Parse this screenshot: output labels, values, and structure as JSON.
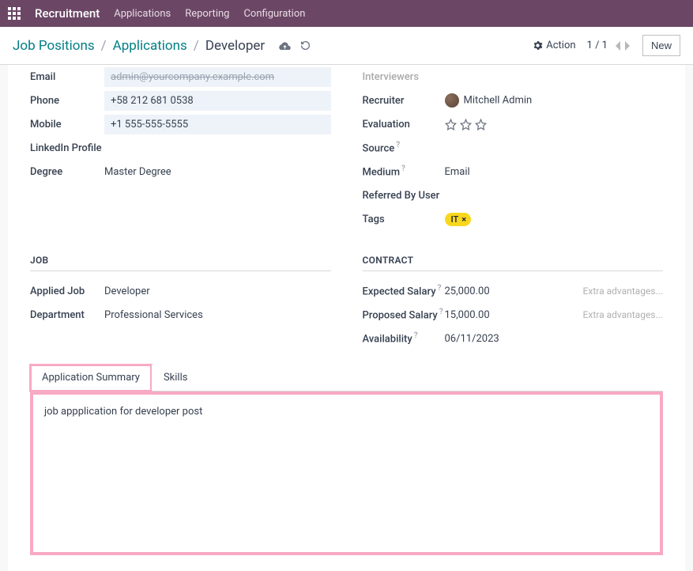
{
  "topbar": {
    "brand": "Recruitment",
    "menu": [
      "Applications",
      "Reporting",
      "Configuration"
    ]
  },
  "header": {
    "breadcrumb": {
      "items": [
        "Job Positions",
        "Applications"
      ],
      "current": "Developer"
    },
    "action_label": "Action",
    "pager": "1 / 1",
    "new_label": "New"
  },
  "left": {
    "email_label": "Email",
    "email_value": "admin@yourcompany.example.com",
    "phone_label": "Phone",
    "phone_value": "+58 212 681 0538",
    "mobile_label": "Mobile",
    "mobile_value": "+1 555-555-5555",
    "linkedin_label": "LinkedIn Profile",
    "linkedin_value": "",
    "degree_label": "Degree",
    "degree_value": "Master Degree"
  },
  "right": {
    "interviewers_label": "Interviewers",
    "recruiter_label": "Recruiter",
    "recruiter_value": "Mitchell Admin",
    "evaluation_label": "Evaluation",
    "source_label": "Source",
    "medium_label": "Medium",
    "medium_value": "Email",
    "referred_label": "Referred By User",
    "tags_label": "Tags",
    "tag_text": "IT"
  },
  "job": {
    "title": "JOB",
    "applied_label": "Applied Job",
    "applied_value": "Developer",
    "dept_label": "Department",
    "dept_value": "Professional Services"
  },
  "contract": {
    "title": "CONTRACT",
    "expected_label": "Expected Salary",
    "expected_value": "25,000.00",
    "proposed_label": "Proposed Salary",
    "proposed_value": "15,000.00",
    "extra_placeholder": "Extra advantages...",
    "avail_label": "Availability",
    "avail_value": "06/11/2023"
  },
  "tabs": {
    "summary": "Application Summary",
    "skills": "Skills"
  },
  "summary_text": "job appplication for developer post"
}
